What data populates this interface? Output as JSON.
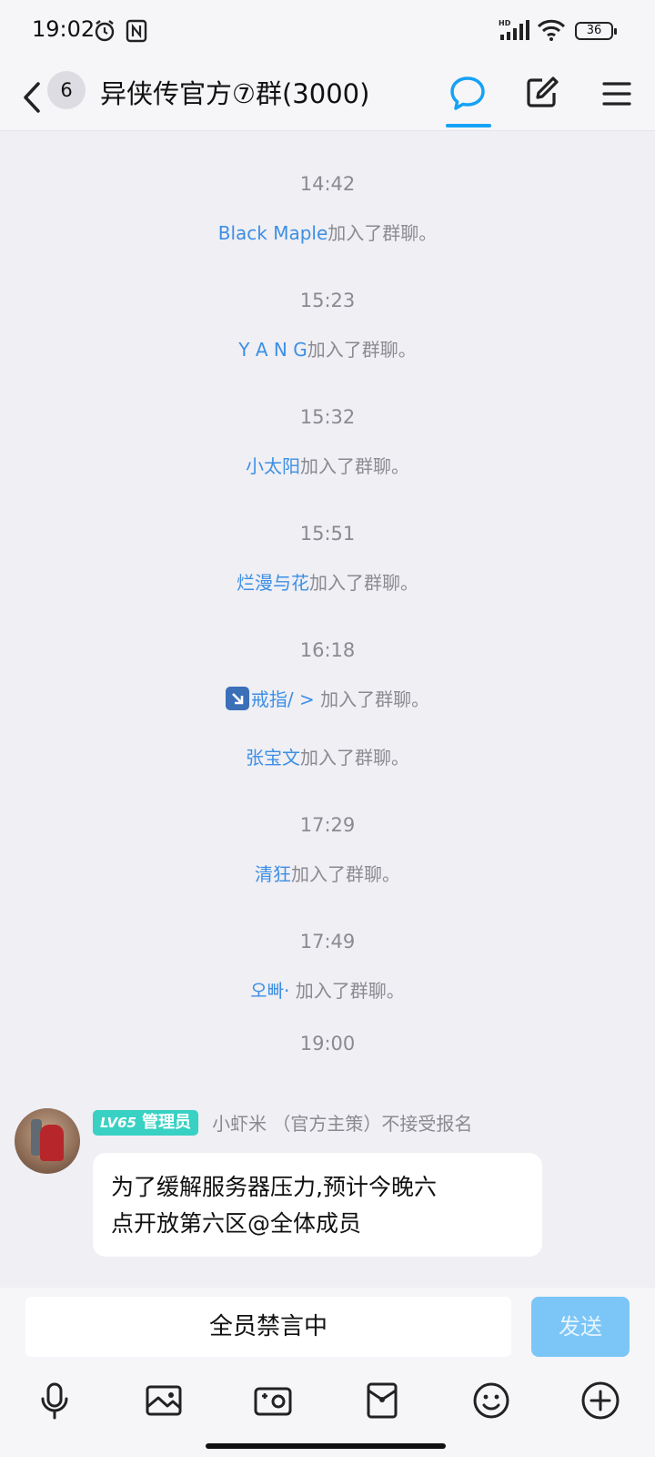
{
  "status_bar": {
    "time": "19:02",
    "network": "HD",
    "battery": "36"
  },
  "header": {
    "unread_count": "6",
    "title": "异侠传官方⑦群(3000)",
    "accent_color": "#16a2f5"
  },
  "timeline": [
    {
      "time": "14:42",
      "events": [
        {
          "nick": "Black Maple",
          "text": "加入了群聊。"
        }
      ]
    },
    {
      "time": "15:23",
      "events": [
        {
          "nick": "Y A N G",
          "text": "加入了群聊。"
        }
      ]
    },
    {
      "time": "15:32",
      "events": [
        {
          "nick": "小太阳",
          "text": "加入了群聊。"
        }
      ]
    },
    {
      "time": "15:51",
      "events": [
        {
          "nick": "烂漫与花",
          "text": "加入了群聊。"
        }
      ]
    },
    {
      "time": "16:18",
      "events": [
        {
          "nick": "戒指/ >",
          "text": "加入了群聊。"
        },
        {
          "nick": "张宝文",
          "text": "加入了群聊。"
        }
      ]
    },
    {
      "time": "17:29",
      "events": [
        {
          "nick": "清狂",
          "text": "加入了群聊。"
        }
      ]
    },
    {
      "time": "17:49",
      "events": [
        {
          "nick": "오빠·",
          "text": "加入了群聊。"
        }
      ]
    },
    {
      "time": "19:00",
      "events": []
    }
  ],
  "message": {
    "level": "LV65",
    "role": "管理员",
    "sender": "小虾米 （官方主策）不接受报名",
    "text_line1": "为了缓解服务器压力,预计今晚六",
    "text_line2": "点开放第六区@全体成员"
  },
  "input": {
    "muted_text": "全员禁言中",
    "send_label": "发送"
  },
  "toolbar": [
    "mic-icon",
    "image-icon",
    "camera-icon",
    "red-packet-icon",
    "emoji-icon",
    "plus-icon"
  ]
}
